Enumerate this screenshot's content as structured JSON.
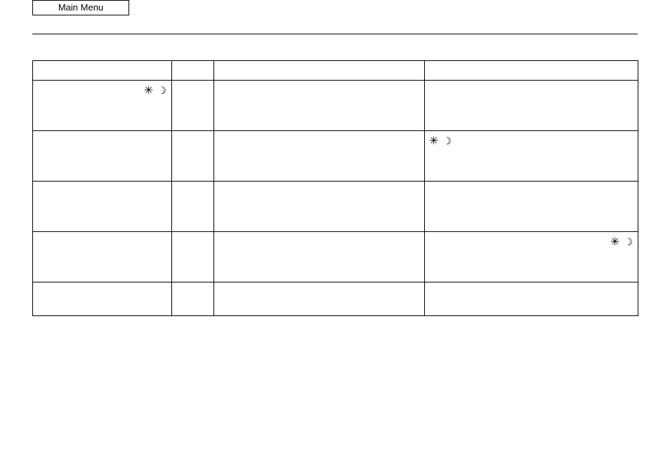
{
  "main_menu_label": "Main Menu",
  "icons": {
    "sun_glyph": "✳",
    "moon_glyph": "☽"
  },
  "table": {
    "headers": [
      "",
      "",
      "",
      ""
    ],
    "rows": [
      {
        "c1_icons": true,
        "c4_icons": false,
        "c4_icons_pos": "left"
      },
      {
        "c1_icons": false,
        "c4_icons": true,
        "c4_icons_pos": "left"
      },
      {
        "c1_icons": false,
        "c4_icons": false,
        "c4_icons_pos": "left"
      },
      {
        "c1_icons": false,
        "c4_icons": true,
        "c4_icons_pos": "right"
      },
      {
        "c1_icons": false,
        "c4_icons": false,
        "c4_icons_pos": "left",
        "last": true
      }
    ]
  }
}
